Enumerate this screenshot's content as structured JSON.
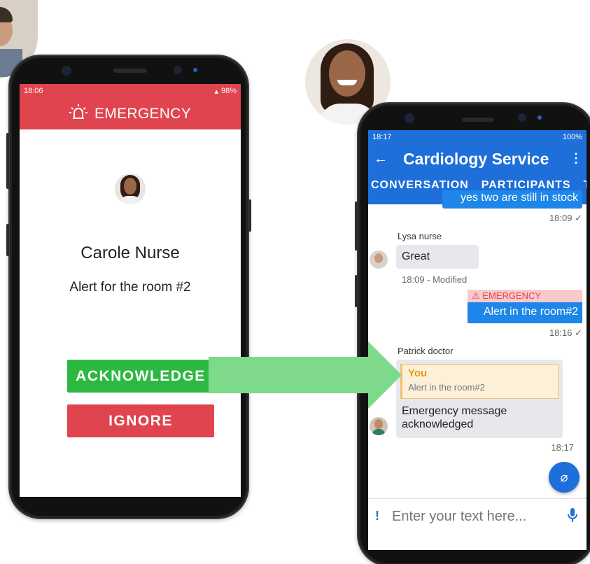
{
  "phone1": {
    "status_time": "18:06",
    "status_battery": "98%",
    "header_title": "EMERGENCY",
    "caller_name": "Carole Nurse",
    "alert_text": "Alert for the room #2",
    "acknowledge_label": "ACKNOWLEDGE",
    "ignore_label": "IGNORE",
    "colors": {
      "header": "#e0444f",
      "acknowledge": "#2db842",
      "ignore": "#e0444f"
    }
  },
  "phone2": {
    "status_time": "18:17",
    "status_battery": "100%",
    "title": "Cardiology Service",
    "tabs": [
      "CONVERSATION",
      "PARTICIPANTS",
      "T"
    ],
    "messages": {
      "top_partial": {
        "text": "yes two are still in stock",
        "time": "18:09"
      },
      "lysa": {
        "sender": "Lysa nurse",
        "text": "Great",
        "meta": "18:09 - Modified"
      },
      "emergency": {
        "label": "EMERGENCY",
        "text": "Alert in the room#2",
        "time": "18:16"
      },
      "patrick": {
        "sender": "Patrick doctor",
        "quote_author": "You",
        "quote_text": "Alert in the room#2",
        "text_line1": "Emergency message",
        "text_line2": "acknowledged",
        "time": "18:17"
      }
    },
    "input_placeholder": "Enter your text here...",
    "icons": [
      "back-arrow-icon",
      "more-vertical-icon",
      "attach-icon",
      "mic-icon",
      "priority-icon",
      "siren-icon"
    ],
    "colors": {
      "primary": "#1e6fd9",
      "bubble_out": "#1e86e8",
      "emergency_tag": "#f8c9cd",
      "quote_border": "#f0a020"
    }
  },
  "flow_arrow_color": "#7ed98a"
}
